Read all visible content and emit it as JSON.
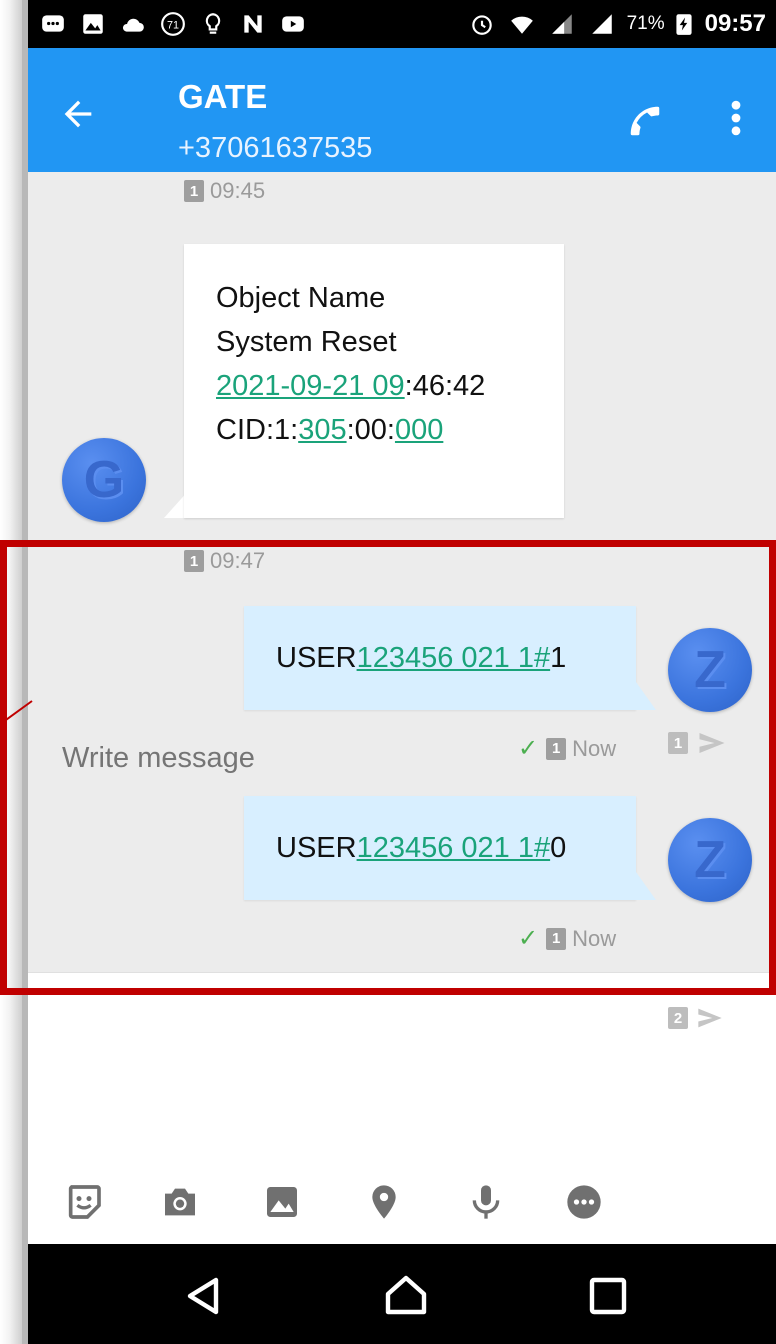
{
  "status_bar": {
    "icons": [
      "chat-bubble-icon",
      "image-icon",
      "cloud-icon",
      "number-71-icon",
      "lightbulb-icon",
      "n-logo-icon",
      "youtube-icon",
      "alarm-icon",
      "wifi-icon",
      "signal-icon",
      "signal-icon"
    ],
    "badge_71": "71",
    "battery_percent": "71%",
    "time": "09:57"
  },
  "app_bar": {
    "title": "GATE",
    "phone_number": "+37061637535"
  },
  "messages": {
    "first_timestamp": "09:45",
    "first_sim": "1",
    "incoming": {
      "line1": "Object Name",
      "line2": "System Reset",
      "line3_link": "2021-09-21 09",
      "line3_rest": ":46:42",
      "line4_prefix": "CID:1:",
      "line4_link1": "305",
      "line4_mid": ":00:",
      "line4_link2": "000",
      "avatar_letter": "G"
    },
    "second_timestamp": "09:47",
    "second_sim": "1",
    "outgoing": [
      {
        "prefix": "USER",
        "link": "123456 021 1#",
        "suffix": "1",
        "status": "Now",
        "sim": "1",
        "avatar_letter": "Z"
      },
      {
        "prefix": "USER",
        "link": "123456 021 1#",
        "suffix": "0",
        "status": "Now",
        "sim": "1",
        "avatar_letter": "Z"
      }
    ]
  },
  "composer": {
    "placeholder": "Write message",
    "send_sim2": "2",
    "send_sim1": "1"
  },
  "colors": {
    "app_bar": "#2196f3",
    "outgoing_bubble": "#d8efff",
    "link": "#1aa37a",
    "highlight": "#c00000"
  }
}
